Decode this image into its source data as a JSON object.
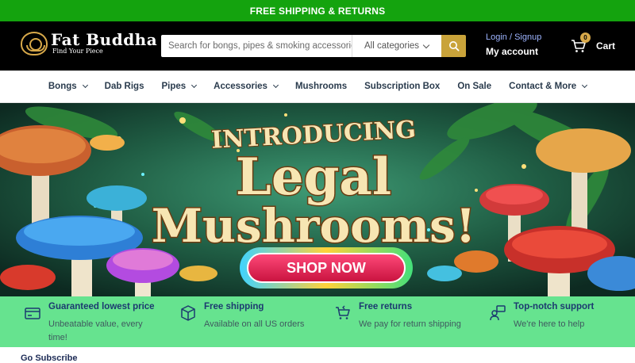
{
  "topbar": {
    "text": "FREE SHIPPING & RETURNS"
  },
  "header": {
    "logo_title": "Fat Buddha",
    "logo_tagline": "Find Your Piece",
    "search_placeholder": "Search for bongs, pipes & smoking accessories",
    "category_select": "All categories",
    "login_label": "Login / Signup",
    "account_label": "My account",
    "cart_count": "0",
    "cart_label": "Cart",
    "accent": "#c9a33a"
  },
  "nav": {
    "items": [
      {
        "label": "Bongs",
        "dropdown": true
      },
      {
        "label": "Dab Rigs",
        "dropdown": false
      },
      {
        "label": "Pipes",
        "dropdown": true
      },
      {
        "label": "Accessories",
        "dropdown": true
      },
      {
        "label": "Mushrooms",
        "dropdown": false
      },
      {
        "label": "Subscription Box",
        "dropdown": false
      },
      {
        "label": "On Sale",
        "dropdown": false
      },
      {
        "label": "Contact & More",
        "dropdown": true
      }
    ]
  },
  "banner": {
    "line1": "INTRODUCING",
    "line2": "Legal",
    "line3": "Mushrooms!",
    "cta": "SHOP NOW"
  },
  "features": [
    {
      "icon": "credit-card-icon",
      "title": "Guaranteed lowest price",
      "desc": "Unbeatable value, every time!"
    },
    {
      "icon": "box-icon",
      "title": "Free shipping",
      "desc": "Available on all US orders"
    },
    {
      "icon": "cart-return-icon",
      "title": "Free returns",
      "desc": "We pay for return shipping"
    },
    {
      "icon": "support-icon",
      "title": "Top-notch support",
      "desc": "We're here to help"
    }
  ],
  "colors": {
    "topbar": "#14a30e",
    "features_bg": "#66e38f",
    "nav_text": "#2a3b4d"
  },
  "next_section_heading": "Go Subscribe"
}
